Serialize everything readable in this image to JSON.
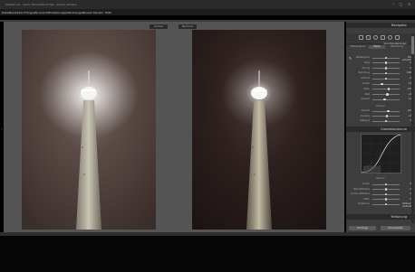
{
  "window": {
    "title": "Captain ob - berlin Fernsehturm fall - Adobe Camera"
  },
  "menu": [
    {
      "name": "menu-datei",
      "label": "Datei"
    },
    {
      "name": "menu-bearbeiten",
      "label": "Bearbeiten"
    },
    {
      "name": "menu-fotografie",
      "label": "Fotografie"
    },
    {
      "name": "menu-ansicht",
      "label": "Ansicht"
    },
    {
      "name": "menu-einstellungen",
      "label": "Einstellungen"
    },
    {
      "name": "menu-werkzeuge",
      "label": "Werkzeuge"
    },
    {
      "name": "menu-bereich",
      "label": "Bereich"
    },
    {
      "name": "menu-fenster",
      "label": "Fenster"
    },
    {
      "name": "menu-hilfe",
      "label": "Hilfe"
    }
  ],
  "viewer": {
    "before_label": "Vorher",
    "after_label": "Nachher"
  },
  "panel": {
    "navigator_title": "Navigator",
    "basic_title": "Grundeinstellungen",
    "subtabs": [
      "Weißabgleich",
      "Farbe",
      "Belichtung"
    ],
    "basic_sliders": [
      {
        "label": "Weißabgleich",
        "value": "Wie Aufnahme",
        "pos": 0.5
      },
      {
        "label": "Temp",
        "value": "0",
        "pos": 0.5
      },
      {
        "label": "Tönung",
        "value": "0",
        "pos": 0.5
      },
      {
        "label": "Belichtung",
        "value": "0,00",
        "pos": 0.5
      },
      {
        "label": "Kontrast",
        "value": "0",
        "pos": 0.5
      },
      {
        "label": "Lichter",
        "value": "-53",
        "pos": 0.35
      },
      {
        "label": "Tiefen",
        "value": "+23",
        "pos": 0.6
      },
      {
        "label": "Weiß",
        "value": "+8",
        "pos": 0.55
      },
      {
        "label": "Schwarz",
        "value": "-12",
        "pos": 0.45
      }
    ],
    "presence_title": "Präsenz",
    "presence_sliders": [
      {
        "label": "Klarheit",
        "value": "+16",
        "pos": 0.58
      },
      {
        "label": "Dynamik",
        "value": "+5",
        "pos": 0.53
      },
      {
        "label": "Sättigung",
        "value": "0",
        "pos": 0.5
      }
    ],
    "curve_title": "Gradationskurve",
    "region_title": "Bereich",
    "region_sliders": [
      {
        "label": "Lichter",
        "value": "0",
        "pos": 0.5
      },
      {
        "label": "Helle Mitteltöne",
        "value": "0",
        "pos": 0.5
      },
      {
        "label": "Dunkle Mitteltöne",
        "value": "0",
        "pos": 0.5
      },
      {
        "label": "Tiefen",
        "value": "0",
        "pos": 0.5
      },
      {
        "label": "Punktkurve",
        "value": "Mittlerer Kontrast",
        "pos": 0.5
      }
    ],
    "footer_title": "Teiltonung",
    "btn_left": "Vorherige",
    "btn_right": "Zurücksetzen"
  },
  "colors": {
    "panel_bg": "#3d3d3d",
    "viewer_bg": "#545454",
    "accent": "#dadada"
  }
}
